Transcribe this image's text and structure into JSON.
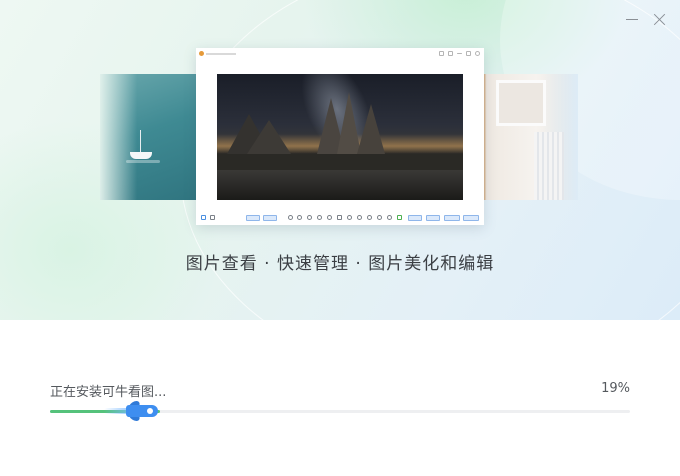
{
  "hero": {
    "tagline": "图片查看 · 快速管理 · 图片美化和编辑"
  },
  "install": {
    "status_text": "正在安装可牛看图...",
    "progress_percent": 19,
    "progress_label": "19%"
  },
  "colors": {
    "progress_fill": "#55c27b",
    "rocket": "#3e8ef0"
  },
  "icons": [
    "minimize-icon",
    "close-icon",
    "rocket-icon"
  ]
}
